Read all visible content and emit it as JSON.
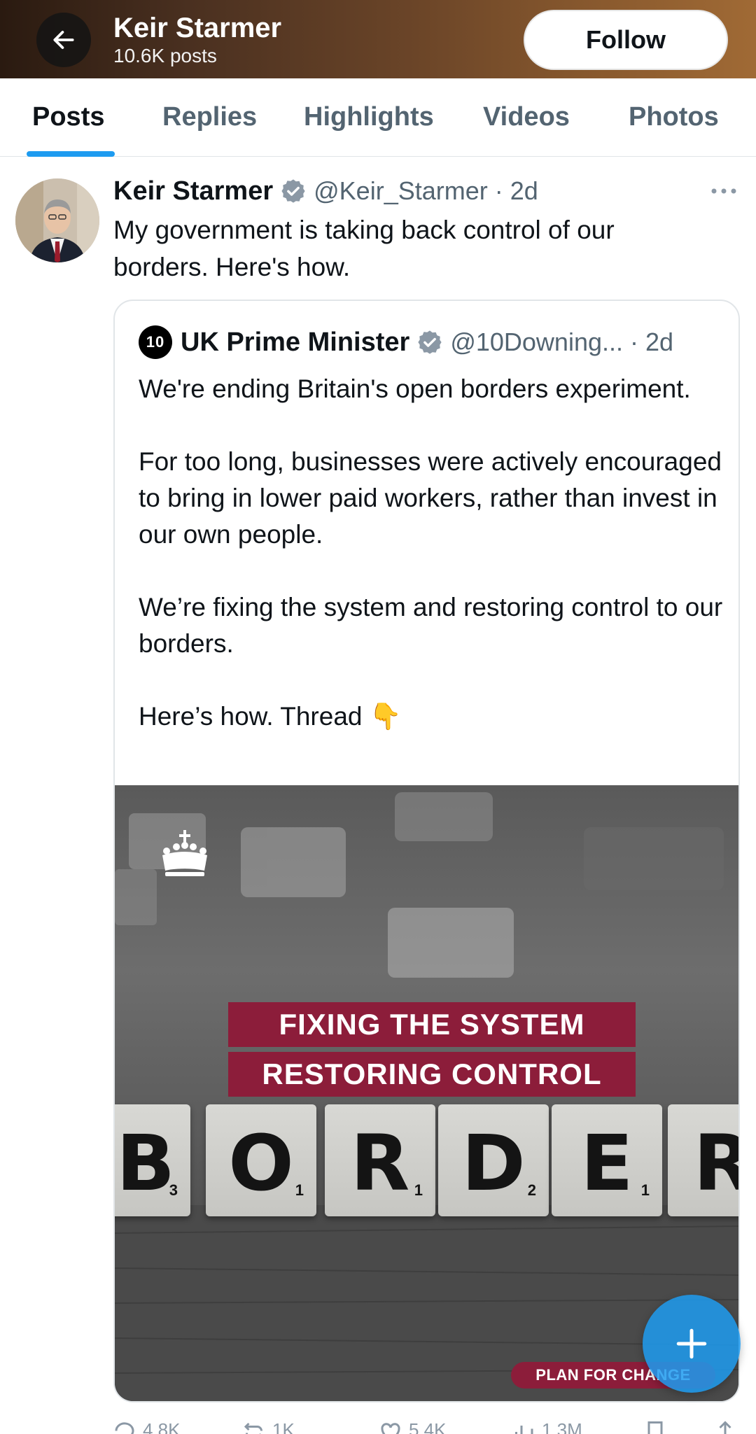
{
  "header": {
    "name": "Keir Starmer",
    "posts_count": "10.6K posts",
    "follow_label": "Follow",
    "back_icon": "arrow-left-icon"
  },
  "tabs": [
    {
      "label": "Posts",
      "active": true
    },
    {
      "label": "Replies",
      "active": false
    },
    {
      "label": "Highlights",
      "active": false
    },
    {
      "label": "Videos",
      "active": false
    },
    {
      "label": "Photos",
      "active": false
    }
  ],
  "post": {
    "author_name": "Keir Starmer",
    "handle_time": "@Keir_Starmer · 2d",
    "text": "My government is taking back control of our borders. Here's how.",
    "more_icon": "more-horizontal-icon"
  },
  "quote": {
    "logo_text": "10",
    "author_name": "UK Prime Minister",
    "handle_time": "@10Downing... · 2d",
    "paragraphs": [
      "We're ending Britain's open borders experiment.",
      "For too long, businesses were actively encouraged to bring in lower paid workers, rather than invest in our own people.",
      "We’re fixing the system and restoring control to our borders.",
      "Here’s how. Thread 👇"
    ],
    "media": {
      "banner_line1": "FIXING THE SYSTEM",
      "banner_line2": "RESTORING CONTROL",
      "tiles": [
        {
          "letter": "B",
          "score": "3"
        },
        {
          "letter": "O",
          "score": "1"
        },
        {
          "letter": "R",
          "score": "1"
        },
        {
          "letter": "D",
          "score": "2"
        },
        {
          "letter": "E",
          "score": "1"
        },
        {
          "letter": "R",
          "score": ""
        }
      ],
      "plan_label": "PLAN FOR CHANGE"
    }
  },
  "actions": {
    "replies": "4.8K",
    "reposts": "1K",
    "likes": "5.4K",
    "views": "1.3M"
  },
  "colors": {
    "accent": "#1d9bf0",
    "banner": "#8c1d3a",
    "text_secondary": "#536471"
  }
}
